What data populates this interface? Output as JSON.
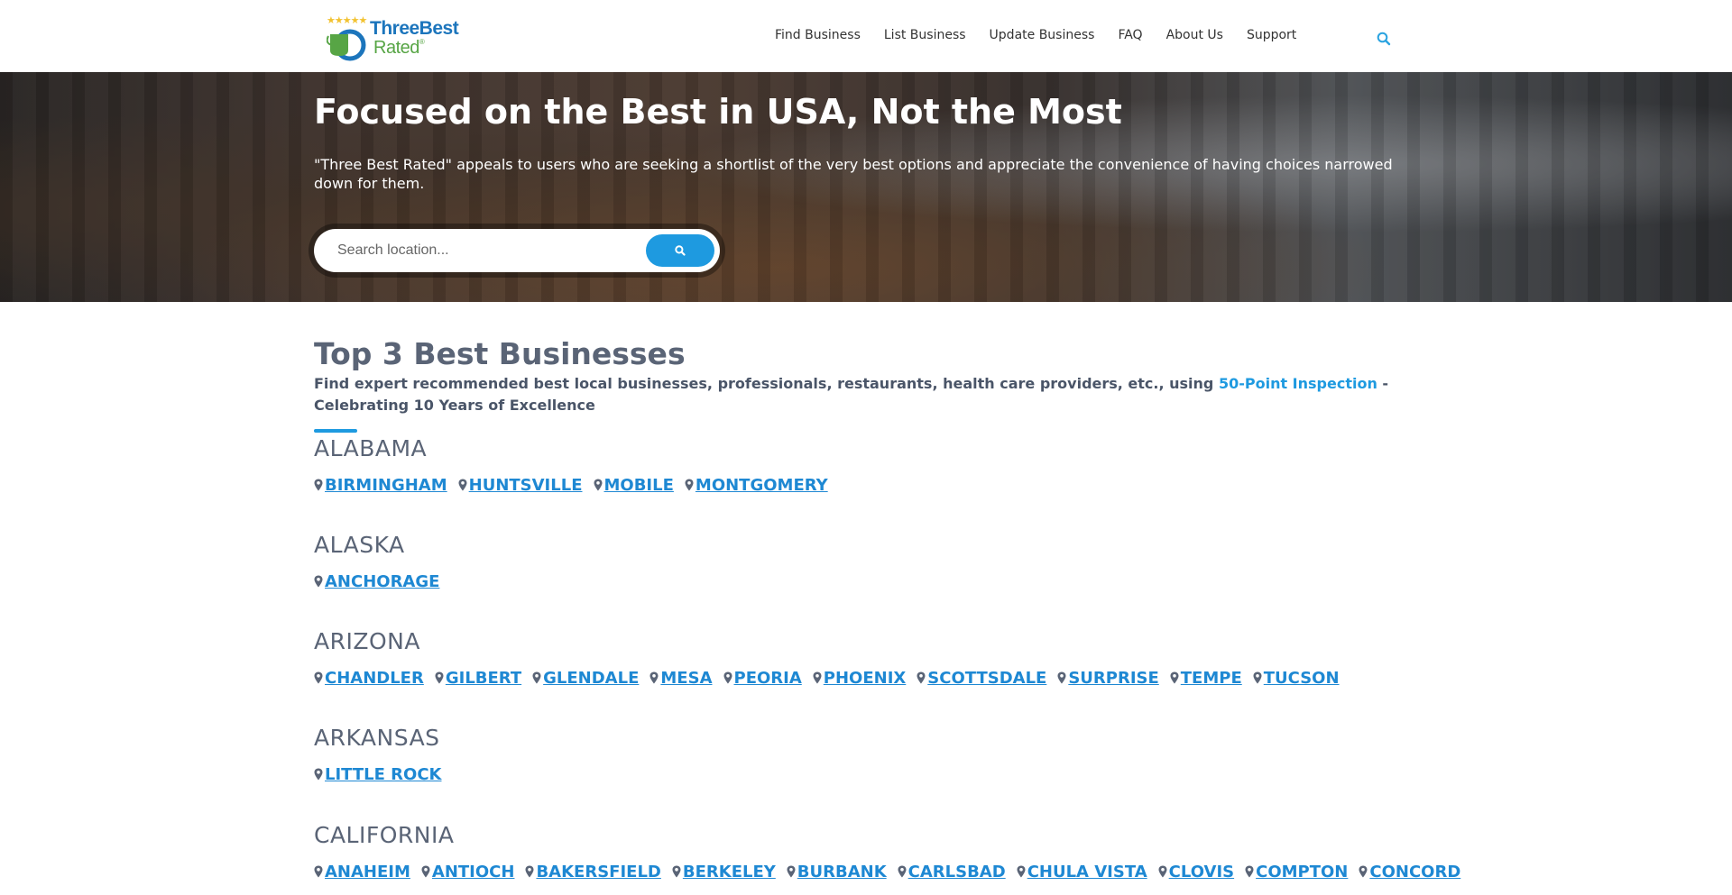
{
  "brand": {
    "name_line1": "ThreeBest",
    "name_line2": "Rated",
    "reg": "®",
    "stars": "★★★★★"
  },
  "nav": {
    "items": [
      "Find Business",
      "List Business",
      "Update Business",
      "FAQ",
      "About Us",
      "Support"
    ]
  },
  "hero": {
    "title": "Focused on the Best in USA, Not the Most",
    "description": "\"Three Best Rated\" appeals to users who are seeking a shortlist of the very best options and appreciate the convenience of having choices narrowed down for them.",
    "search_placeholder": "Search location..."
  },
  "main": {
    "title": "Top 3 Best Businesses",
    "subtitle_pre": "Find expert recommended best local businesses, professionals, restaurants, health care providers, etc., using ",
    "subtitle_link": "50-Point Inspection",
    "subtitle_post": " - Celebrating 10 Years of Excellence"
  },
  "states": [
    {
      "name": "ALABAMA",
      "cities": [
        "BIRMINGHAM",
        "HUNTSVILLE",
        "MOBILE",
        "MONTGOMERY"
      ]
    },
    {
      "name": "ALASKA",
      "cities": [
        "ANCHORAGE"
      ]
    },
    {
      "name": "ARIZONA",
      "cities": [
        "CHANDLER",
        "GILBERT",
        "GLENDALE",
        "MESA",
        "PEORIA",
        "PHOENIX",
        "SCOTTSDALE",
        "SURPRISE",
        "TEMPE",
        "TUCSON"
      ]
    },
    {
      "name": "ARKANSAS",
      "cities": [
        "LITTLE ROCK"
      ]
    },
    {
      "name": "CALIFORNIA",
      "cities": [
        "ANAHEIM",
        "ANTIOCH",
        "BAKERSFIELD",
        "BERKELEY",
        "BURBANK",
        "CARLSBAD",
        "CHULA VISTA",
        "CLOVIS",
        "COMPTON",
        "CONCORD"
      ]
    }
  ],
  "colors": {
    "accent": "#1e9ae0",
    "link": "#1e88d3",
    "heading": "#5a6476",
    "brand_blue": "#1c75bc",
    "brand_green": "#57a545"
  },
  "icons": {
    "header_search": "search-icon",
    "hero_search": "search-icon",
    "city": "map-marker-icon"
  }
}
